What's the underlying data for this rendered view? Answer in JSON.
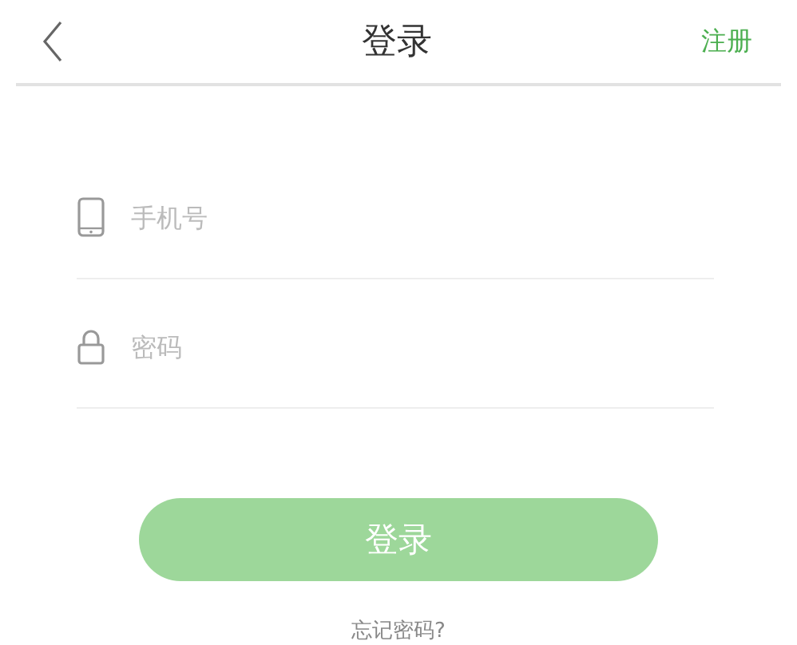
{
  "header": {
    "title": "登录",
    "action": "注册"
  },
  "fields": [
    {
      "kind": "phone",
      "placeholder": "手机号"
    },
    {
      "kind": "password",
      "placeholder": "密码"
    }
  ],
  "submit": {
    "label": "登录",
    "disabled": true
  },
  "forgot_link": "忘记密码?"
}
